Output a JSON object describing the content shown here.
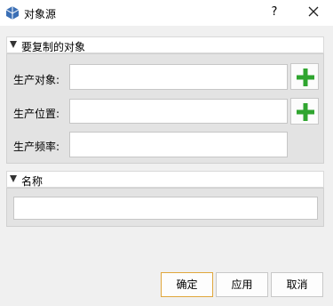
{
  "window": {
    "title": "对象源",
    "help": "?"
  },
  "sections": {
    "copy": {
      "title": "要复制的对象",
      "rows": [
        {
          "label": "生产对象:",
          "value": ""
        },
        {
          "label": "生产位置:",
          "value": ""
        },
        {
          "label": "生产频率:",
          "value": ""
        }
      ]
    },
    "name": {
      "title": "名称",
      "value": ""
    }
  },
  "buttons": {
    "ok": "确定",
    "apply": "应用",
    "cancel": "取消"
  },
  "colors": {
    "add_icon": "#2fa52f",
    "accent_border": "#e0a73c"
  }
}
